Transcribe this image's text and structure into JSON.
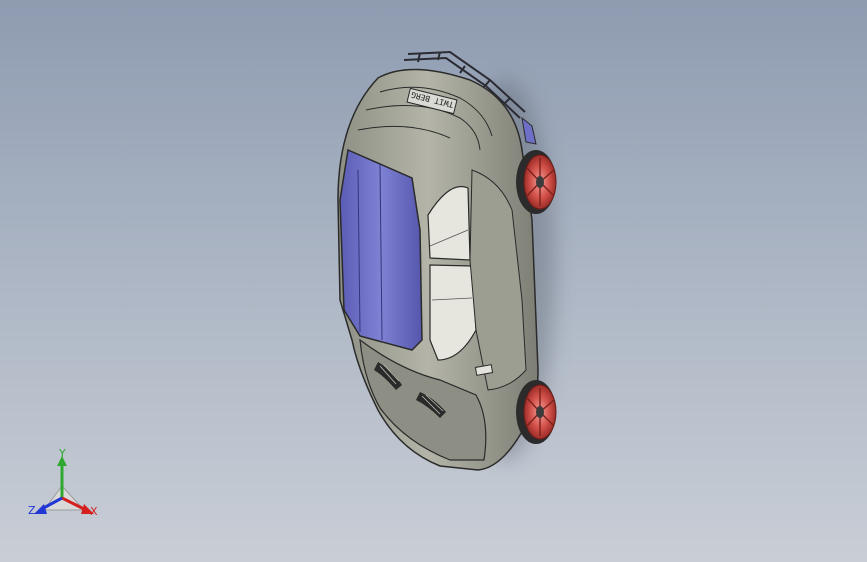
{
  "viewport": {
    "background_top": "#8e9bb0",
    "background_bottom": "#c9ced6"
  },
  "model": {
    "badge_text": "TWIT BERG",
    "body_color": "#a7a89a",
    "roof_color": "#6e70c8",
    "glass_color": "#e6e6df",
    "rim_color": "#d3514a"
  },
  "triad": {
    "x_label": "X",
    "y_label": "Y",
    "z_label": "Z",
    "x_color": "#d52020",
    "y_color": "#2ea82e",
    "z_color": "#2037d6"
  }
}
